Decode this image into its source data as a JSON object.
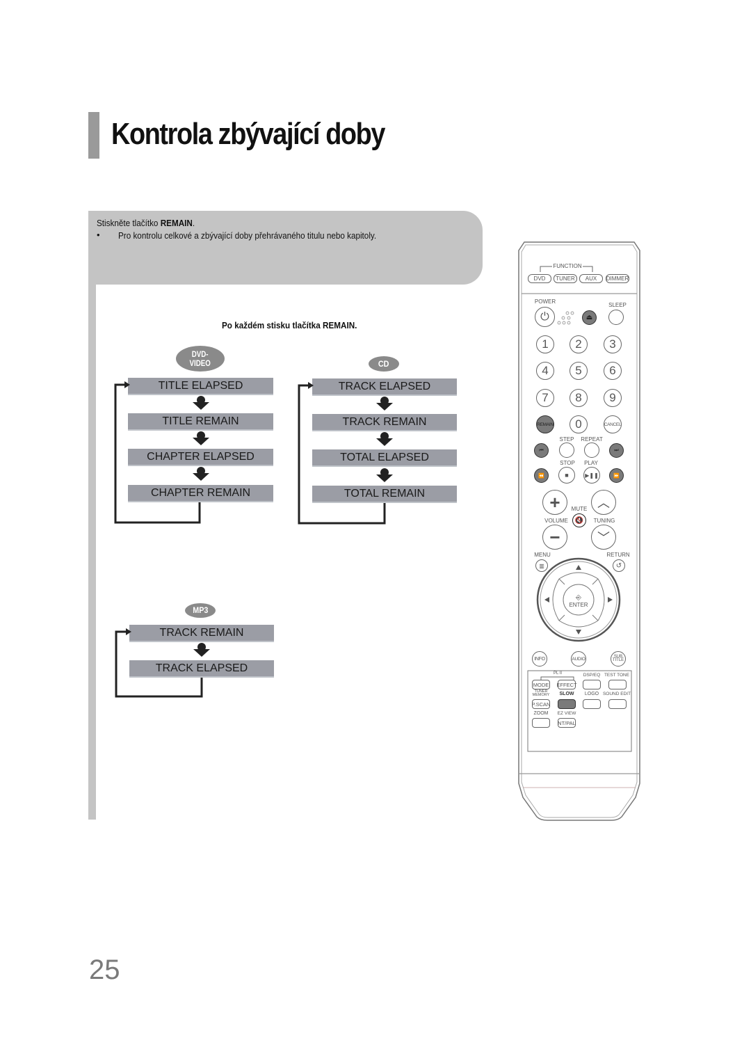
{
  "page": {
    "title": "Kontrola zbývající doby",
    "page_number": "25",
    "accent_bar_color": "#9a9a9a",
    "panel_color": "#c4c4c4"
  },
  "instructions": {
    "step_prefix": "Stiskněte tlačítko ",
    "step_button": "REMAIN",
    "step_suffix": ".",
    "bullet_symbol": "•",
    "bullet_text": "Pro kontrolu celkové a zbývající doby přehrávaného titulu nebo kapitoly."
  },
  "diagram": {
    "heading": "Po každém stisku tlačítka REMAIN.",
    "box_color": "#9b9da5",
    "flows": [
      {
        "badge": "DVD-VIDEO",
        "badge_lines": [
          "DVD-",
          "VIDEO"
        ],
        "steps": [
          "TITLE ELAPSED",
          "TITLE REMAIN",
          "CHAPTER ELAPSED",
          "CHAPTER REMAIN"
        ]
      },
      {
        "badge": "CD",
        "badge_lines": [
          "CD"
        ],
        "steps": [
          "TRACK ELAPSED",
          "TRACK REMAIN",
          "TOTAL ELAPSED",
          "TOTAL REMAIN"
        ]
      },
      {
        "badge": "MP3",
        "badge_lines": [
          "MP3"
        ],
        "steps": [
          "TRACK REMAIN",
          "TRACK ELAPSED"
        ]
      }
    ]
  },
  "remote": {
    "function_label": "FUNCTION",
    "function_buttons": [
      "DVD",
      "TUNER",
      "AUX",
      "DIMMER"
    ],
    "power_label": "POWER",
    "sleep_label": "SLEEP",
    "number_buttons": [
      "1",
      "2",
      "3",
      "4",
      "5",
      "6",
      "7",
      "8",
      "9"
    ],
    "remain_label": "REMAIN",
    "zero_label": "0",
    "cancel_label": "CANCEL",
    "step_label": "STEP",
    "repeat_label": "REPEAT",
    "stop_label": "STOP",
    "play_label": "PLAY",
    "mute_label": "MUTE",
    "volume_label": "VOLUME",
    "tuning_label": "TUNING",
    "menu_label": "MENU",
    "return_label": "RETURN",
    "enter_label": "ENTER",
    "info_label": "INFO",
    "audio_label": "AUDIO",
    "subtitle_label": "SUB TITLE",
    "pl2_label": "PL II",
    "mode_label": "MODE",
    "effect_label": "EFFECT",
    "dsp_eq_label": "DSP/EQ",
    "test_tone_label": "TEST TONE",
    "tuner_memory_label": "TUNER MEMORY",
    "pscan_label": "P.SCAN",
    "slow_label": "SLOW",
    "logo_label": "LOGO",
    "sound_edit_label": "SOUND EDIT",
    "zoom_label": "ZOOM",
    "ez_view_label": "EZ VIEW",
    "nt_pal_label": "NT/PAL",
    "highlighted_button": "REMAIN"
  }
}
